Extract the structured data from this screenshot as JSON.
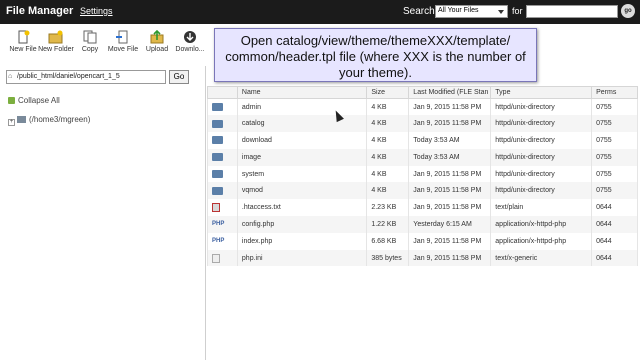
{
  "header": {
    "title": "File Manager",
    "settings": "Settings",
    "search_label": "Search",
    "search_scope": "All Your Files",
    "for_label": "for",
    "search_value": "",
    "go": "go"
  },
  "toolbar": {
    "items": [
      {
        "label": "New File",
        "icon": "new-file-icon"
      },
      {
        "label": "New Folder",
        "icon": "new-folder-icon"
      },
      {
        "label": "Copy",
        "icon": "copy-icon"
      },
      {
        "label": "Move File",
        "icon": "move-file-icon"
      },
      {
        "label": "Upload",
        "icon": "upload-icon"
      },
      {
        "label": "Downlo...",
        "icon": "download-icon"
      }
    ]
  },
  "path": {
    "value": "/public_html/daniel/opencart_1_5",
    "go": "Go"
  },
  "tree": {
    "collapse_all": "Collapse All",
    "root": "(/home3/mgreen)"
  },
  "tooltip": {
    "text": "Open catalog/view/theme/themeXXX/template/ common/header.tpl file (where XXX is the number of your theme)."
  },
  "table": {
    "columns": [
      "",
      "Name",
      "Size",
      "Last Modified (FLE Stan",
      "Type",
      "Perms"
    ],
    "rows": [
      {
        "icon": "folder-icon",
        "name": "admin",
        "size": "4 KB",
        "modified": "Jan 9, 2015 11:58 PM",
        "type": "httpd/unix-directory",
        "perms": "0755"
      },
      {
        "icon": "folder-icon",
        "name": "catalog",
        "size": "4 KB",
        "modified": "Jan 9, 2015 11:58 PM",
        "type": "httpd/unix-directory",
        "perms": "0755"
      },
      {
        "icon": "folder-icon",
        "name": "download",
        "size": "4 KB",
        "modified": "Today 3:53 AM",
        "type": "httpd/unix-directory",
        "perms": "0755"
      },
      {
        "icon": "folder-icon",
        "name": "image",
        "size": "4 KB",
        "modified": "Today 3:53 AM",
        "type": "httpd/unix-directory",
        "perms": "0755"
      },
      {
        "icon": "folder-icon",
        "name": "system",
        "size": "4 KB",
        "modified": "Jan 9, 2015 11:58 PM",
        "type": "httpd/unix-directory",
        "perms": "0755"
      },
      {
        "icon": "folder-icon",
        "name": "vqmod",
        "size": "4 KB",
        "modified": "Jan 9, 2015 11:58 PM",
        "type": "httpd/unix-directory",
        "perms": "0755"
      },
      {
        "icon": "text-file-icon",
        "name": ".htaccess.txt",
        "size": "2.23 KB",
        "modified": "Jan 9, 2015 11:58 PM",
        "type": "text/plain",
        "perms": "0644"
      },
      {
        "icon": "php-file-icon",
        "name": "config.php",
        "size": "1.22 KB",
        "modified": "Yesterday 6:15 AM",
        "type": "application/x-httpd-php",
        "perms": "0644"
      },
      {
        "icon": "php-file-icon",
        "name": "index.php",
        "size": "6.68 KB",
        "modified": "Jan 9, 2015 11:58 PM",
        "type": "application/x-httpd-php",
        "perms": "0644"
      },
      {
        "icon": "ini-file-icon",
        "name": "php.ini",
        "size": "385 bytes",
        "modified": "Jan 9, 2015 11:58 PM",
        "type": "text/x-generic",
        "perms": "0644"
      }
    ]
  }
}
